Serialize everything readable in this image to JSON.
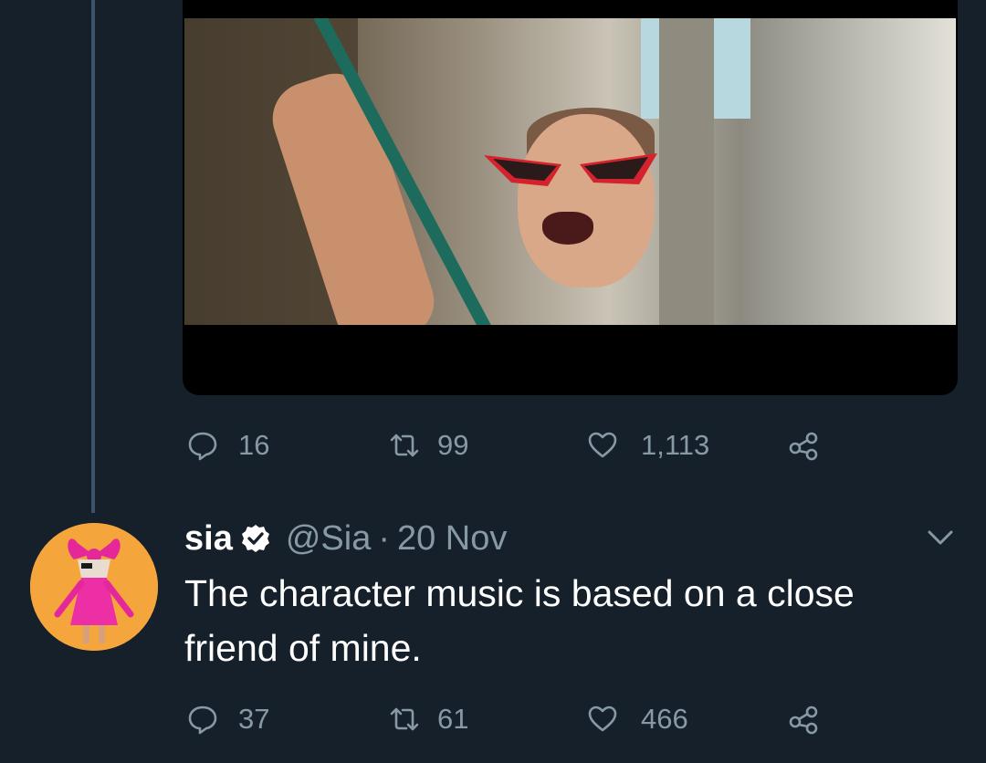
{
  "previous_tweet": {
    "media": {
      "description_icon": "video-thumbnail"
    },
    "actions": {
      "reply_count": "16",
      "retweet_count": "99",
      "like_count": "1,113"
    }
  },
  "tweet": {
    "display_name": "sia",
    "handle": "@Sia",
    "separator": "·",
    "date": "20 Nov",
    "text": "The character music is based on a close friend of mine.",
    "actions": {
      "reply_count": "37",
      "retweet_count": "61",
      "like_count": "466"
    }
  },
  "colors": {
    "background": "#15202b",
    "muted": "#8899a6",
    "thread_line": "#3d5466",
    "verified_badge": "#ffffff",
    "avatar_bg": "#f4a63d"
  },
  "icons": [
    "reply-icon",
    "retweet-icon",
    "like-icon",
    "share-icon",
    "verified-badge-icon",
    "chevron-down-icon"
  ]
}
